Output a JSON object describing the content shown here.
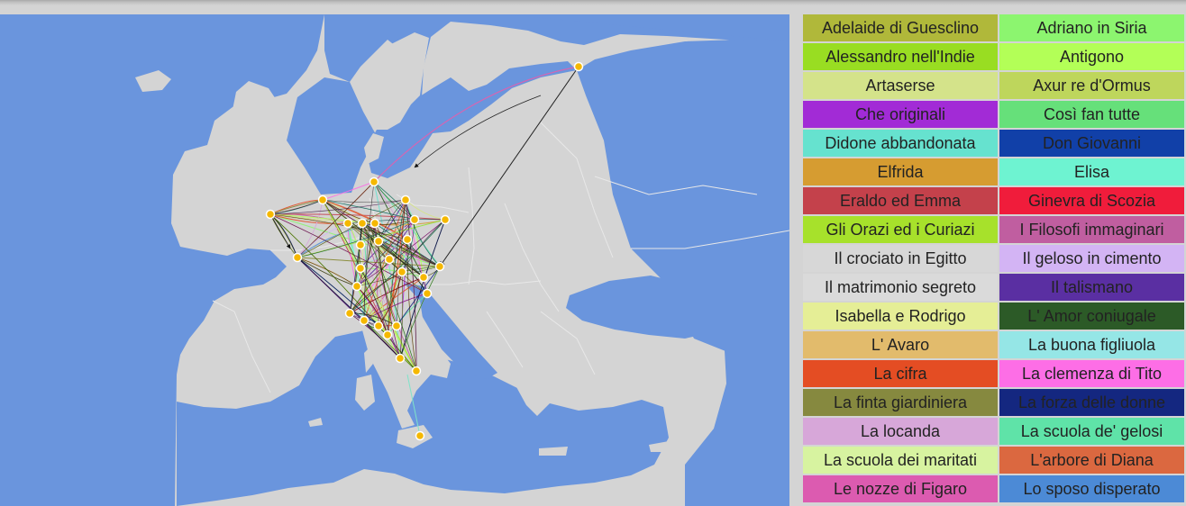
{
  "map": {
    "colors": {
      "sea": "#6a95dd",
      "land": "#d4d4d4",
      "border": "#e8e8e8",
      "marker": "#f5b800",
      "marker_stroke": "#ffffff",
      "arrow": "#111111"
    }
  },
  "legend": {
    "items": [
      {
        "label": "Adelaide di Guesclino",
        "color": "#b0b83a"
      },
      {
        "label": "Adriano in Siria",
        "color": "#8cf56f"
      },
      {
        "label": "Alessandro nell'Indie",
        "color": "#99dd22"
      },
      {
        "label": "Antigono",
        "color": "#b3ff57"
      },
      {
        "label": "Artaserse",
        "color": "#d4e38a"
      },
      {
        "label": "Axur re d'Ormus",
        "color": "#bed65c"
      },
      {
        "label": "Che originali",
        "color": "#a22bd6"
      },
      {
        "label": "Così fan tutte",
        "color": "#66e07a"
      },
      {
        "label": "Didone abbandonata",
        "color": "#66e2cf"
      },
      {
        "label": "Don Giovanni",
        "color": "#1140a8"
      },
      {
        "label": "Elfrida",
        "color": "#d69c31"
      },
      {
        "label": "Elisa",
        "color": "#6ef3d1"
      },
      {
        "label": "Eraldo ed Emma",
        "color": "#c4414b"
      },
      {
        "label": "Ginevra di Scozia",
        "color": "#f01c3b"
      },
      {
        "label": "Gli Orazi ed i Curiazi",
        "color": "#a7e12b"
      },
      {
        "label": "I Filosofi immaginari",
        "color": "#c05ea0"
      },
      {
        "label": "Il crociato in Egitto",
        "color": "#d7d7d7"
      },
      {
        "label": "Il geloso in cimento",
        "color": "#d3b4f4"
      },
      {
        "label": "Il matrimonio segreto",
        "color": "#dadada"
      },
      {
        "label": "Il talismano",
        "color": "#5a2fa2"
      },
      {
        "label": "Isabella e Rodrigo",
        "color": "#e5ee96"
      },
      {
        "label": "L' Amor coniugale",
        "color": "#2c5a27"
      },
      {
        "label": "L' Avaro",
        "color": "#e2bb6c"
      },
      {
        "label": "La buona figliuola",
        "color": "#95e6e6"
      },
      {
        "label": "La cifra",
        "color": "#e44d23"
      },
      {
        "label": "La clemenza di Tito",
        "color": "#fd6ee6"
      },
      {
        "label": "La finta giardiniera",
        "color": "#86893f"
      },
      {
        "label": "La forza delle donne",
        "color": "#142780"
      },
      {
        "label": "La locanda",
        "color": "#d7a7d9"
      },
      {
        "label": "La scuola de' gelosi",
        "color": "#5fe3a8"
      },
      {
        "label": "La scuola dei maritati",
        "color": "#d7f3a0"
      },
      {
        "label": "L'arbore di Diana",
        "color": "#db6840"
      },
      {
        "label": "Le nozze di Figaro",
        "color": "#dc5bb0"
      },
      {
        "label": "Lo sposo disperato",
        "color": "#4c8ad6"
      }
    ]
  }
}
